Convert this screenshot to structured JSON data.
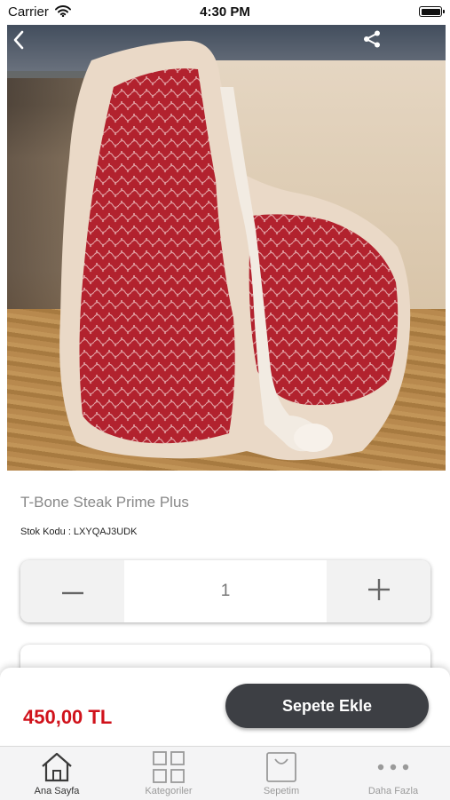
{
  "status_bar": {
    "carrier": "Carrier",
    "time": "4:30 PM"
  },
  "product": {
    "title": "T-Bone Steak Prime Plus",
    "sku_text": "Stok Kodu : LXYQAJ3UDK",
    "quantity": "1",
    "price": "450,00 TL"
  },
  "cart": {
    "add_label": "Sepete Ekle"
  },
  "tabs": [
    {
      "label": "Ana Sayfa",
      "icon": "home-icon",
      "active": true
    },
    {
      "label": "Kategoriler",
      "icon": "grid-icon",
      "active": false
    },
    {
      "label": "Sepetim",
      "icon": "bag-icon",
      "active": false
    },
    {
      "label": "Daha Fazla",
      "icon": "more-icon",
      "active": false
    }
  ],
  "colors": {
    "price": "#d0121b",
    "button": "#3d3f44",
    "tab_active": "#333333",
    "tab_inactive": "#9a9a9a"
  }
}
